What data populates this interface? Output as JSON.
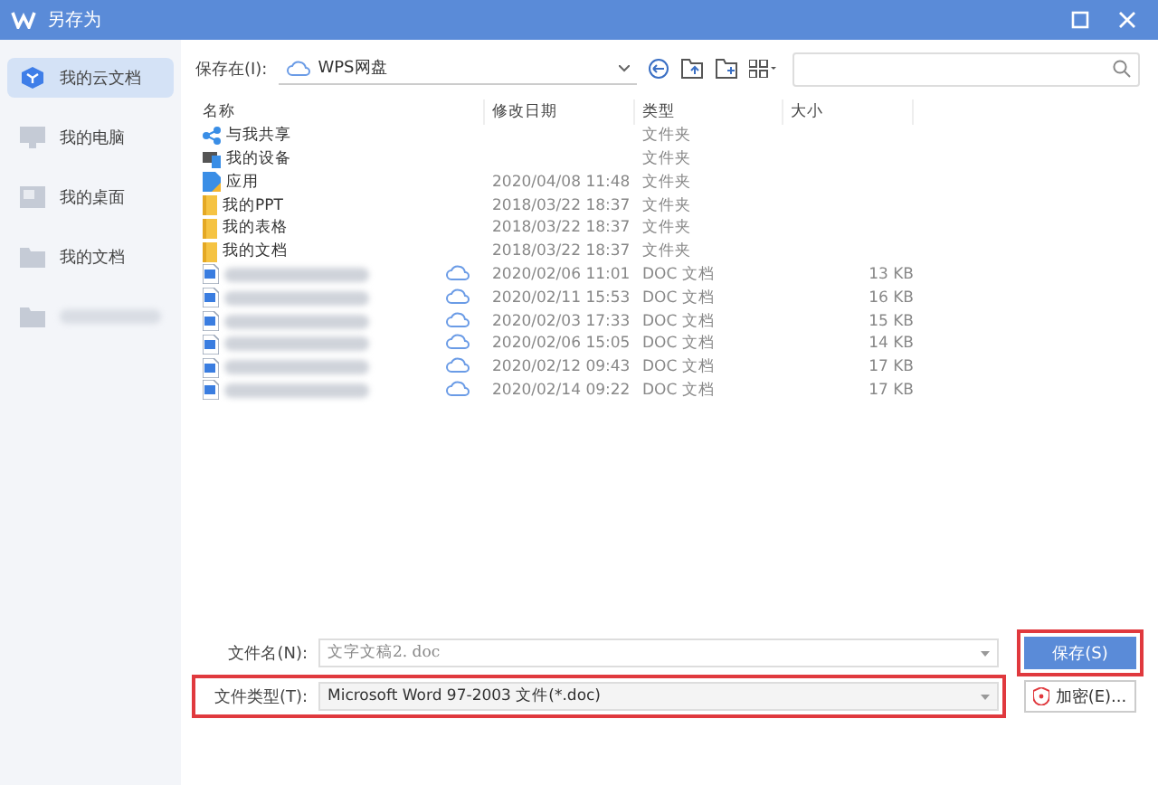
{
  "window": {
    "title": "另存为"
  },
  "sidebar": {
    "items": [
      {
        "label": "我的云文档",
        "kind": "cloud",
        "selected": true
      },
      {
        "label": "我的电脑",
        "kind": "computer",
        "selected": false
      },
      {
        "label": "我的桌面",
        "kind": "desktop",
        "selected": false
      },
      {
        "label": "我的文档",
        "kind": "folder",
        "selected": false
      },
      {
        "kind": "folder",
        "blurred": true,
        "selected": false
      }
    ]
  },
  "location": {
    "label": "保存在(I):",
    "value": "WPS网盘"
  },
  "table": {
    "columns": [
      "名称",
      "修改日期",
      "类型",
      "大小"
    ],
    "rows": [
      {
        "kind": "share",
        "name": "与我共享",
        "synced": false,
        "type": "文件夹"
      },
      {
        "kind": "device",
        "name": "我的设备",
        "synced": false,
        "type": "文件夹"
      },
      {
        "kind": "app",
        "name": "应用",
        "synced": false,
        "date": "2020/04/08 11:48",
        "type": "文件夹"
      },
      {
        "kind": "folder",
        "name": "我的PPT",
        "synced": false,
        "date": "2018/03/22 18:37",
        "type": "文件夹"
      },
      {
        "kind": "folder",
        "name": "我的表格",
        "synced": false,
        "date": "2018/03/22 18:37",
        "type": "文件夹"
      },
      {
        "kind": "folder",
        "name": "我的文档",
        "synced": false,
        "date": "2018/03/22 18:37",
        "type": "文件夹"
      },
      {
        "kind": "doc",
        "synced": true,
        "date": "2020/02/06 11:01",
        "type": "DOC 文档",
        "size": "13 KB"
      },
      {
        "kind": "doc",
        "synced": true,
        "date": "2020/02/11 15:53",
        "type": "DOC 文档",
        "size": "16 KB"
      },
      {
        "kind": "doc",
        "synced": true,
        "date": "2020/02/03 17:33",
        "type": "DOC 文档",
        "size": "15 KB"
      },
      {
        "kind": "doc",
        "synced": true,
        "date": "2020/02/06 15:05",
        "type": "DOC 文档",
        "size": "14 KB"
      },
      {
        "kind": "doc",
        "synced": true,
        "date": "2020/02/12 09:43",
        "type": "DOC 文档",
        "size": "17 KB"
      },
      {
        "kind": "doc",
        "synced": true,
        "date": "2020/02/14 09:22",
        "type": "DOC 文档",
        "size": "17 KB"
      }
    ]
  },
  "file_name": {
    "label": "文件名(N):",
    "value": "文字文稿2. doc",
    "highlighted": false
  },
  "file_type": {
    "label": "文件类型(T):",
    "value": "Microsoft Word 97-2003 文件(*.doc)",
    "highlighted": true
  },
  "buttons": [
    {
      "label": "保存(S)",
      "kind": "primary",
      "highlighted": true
    },
    {
      "label": "加密(E)...",
      "kind": "encrypt",
      "highlighted": false
    }
  ]
}
